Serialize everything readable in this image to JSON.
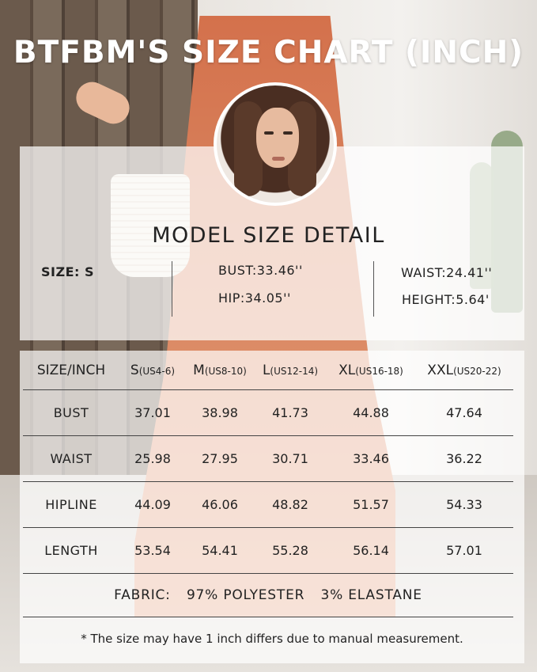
{
  "title": "BTFBM'S SIZE CHART (INCH)",
  "model": {
    "heading": "MODEL SIZE DETAIL",
    "size": "SIZE: S",
    "bust": "BUST:33.46''",
    "hip": "HIP:34.05''",
    "waist": "WAIST:24.41''",
    "height": "HEIGHT:5.64'"
  },
  "table": {
    "corner": "SIZE/INCH",
    "sizes": [
      {
        "label": "S",
        "range": "(US4-6)"
      },
      {
        "label": "M",
        "range": "(US8-10)"
      },
      {
        "label": "L",
        "range": "(US12-14)"
      },
      {
        "label": "XL",
        "range": "(US16-18)"
      },
      {
        "label": "XXL",
        "range": "(US20-22)"
      }
    ],
    "rows": [
      {
        "label": "BUST",
        "values": [
          "37.01",
          "38.98",
          "41.73",
          "44.88",
          "47.64"
        ]
      },
      {
        "label": "WAIST",
        "values": [
          "25.98",
          "27.95",
          "30.71",
          "33.46",
          "36.22"
        ]
      },
      {
        "label": "HIPLINE",
        "values": [
          "44.09",
          "46.06",
          "48.82",
          "51.57",
          "54.33"
        ]
      },
      {
        "label": "LENGTH",
        "values": [
          "53.54",
          "54.41",
          "55.28",
          "56.14",
          "57.01"
        ]
      }
    ]
  },
  "fabric": {
    "label": "FABRIC:",
    "part1": "97% POLYESTER",
    "part2": "3% ELASTANE"
  },
  "note": "* The size may have 1 inch differs due to manual measurement."
}
